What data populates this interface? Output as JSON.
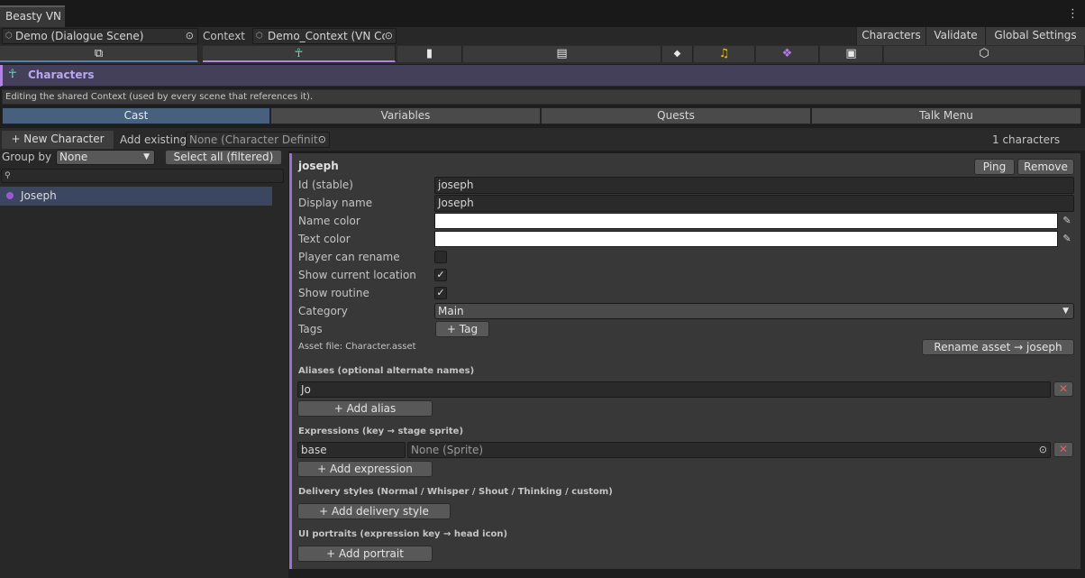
{
  "window": {
    "title": "Beasty VN",
    "menu_icon": "kebab-menu-icon"
  },
  "toolbar": {
    "scene_field": "Demo (Dialogue Scene)",
    "context_label": "Context",
    "context_field": "Demo_Context (VN Cc",
    "buttons": [
      "Characters",
      "Validate",
      "Global Settings"
    ]
  },
  "icon_tabs": [
    {
      "name": "graph-nodes-icon",
      "glyph": "⧉"
    },
    {
      "name": "character-icon",
      "glyph": "☥"
    },
    {
      "name": "page-icon",
      "glyph": "▮"
    },
    {
      "name": "document-icon",
      "glyph": "▤"
    },
    {
      "name": "tag-icon",
      "glyph": "◆"
    },
    {
      "name": "music-note-icon",
      "glyph": "♫"
    },
    {
      "name": "cluster-icon",
      "glyph": "❖"
    },
    {
      "name": "frame-icon",
      "glyph": "▣"
    },
    {
      "name": "cube-icon",
      "glyph": "⬡"
    }
  ],
  "section": {
    "title": "Characters",
    "info": "Editing the shared Context (used by every scene that references it)."
  },
  "subtabs": [
    "Cast",
    "Variables",
    "Quests",
    "Talk Menu"
  ],
  "cast_bar": {
    "new_character": "+ New Character",
    "add_existing": "Add existing",
    "add_existing_field": "None (Character Definiti",
    "count": "1 characters"
  },
  "list": {
    "group_by_label": "Group by",
    "group_by_value": "None",
    "select_all": "Select all (filtered)",
    "search_placeholder": "",
    "items": [
      {
        "name": "Joseph",
        "color": "#9b59d0"
      }
    ]
  },
  "detail": {
    "header": "joseph",
    "ping": "Ping",
    "remove": "Remove",
    "fields": {
      "id_label": "Id (stable)",
      "id_value": "joseph",
      "display_label": "Display name",
      "display_value": "Joseph",
      "name_color_label": "Name color",
      "name_color": "#ffffff",
      "text_color_label": "Text color",
      "text_color": "#ffffff",
      "rename_label": "Player can rename",
      "rename_checked": "",
      "location_label": "Show current location",
      "location_checked": "✓",
      "routine_label": "Show routine",
      "routine_checked": "✓",
      "category_label": "Category",
      "category_value": "Main",
      "tags_label": "Tags",
      "add_tag": "+ Tag",
      "asset_file": "Asset file: Character.asset",
      "rename_asset": "Rename asset → joseph"
    },
    "aliases": {
      "title": "Aliases (optional alternate names)",
      "items": [
        "Jo"
      ],
      "add": "+ Add alias"
    },
    "expressions": {
      "title": "Expressions (key → stage sprite)",
      "key": "base",
      "sprite": "None (Sprite)",
      "add": "+ Add expression"
    },
    "delivery": {
      "title": "Delivery styles (Normal / Whisper / Shout / Thinking / custom)",
      "add": "+ Add delivery style"
    },
    "portraits": {
      "title": "UI portraits (expression key → head icon)",
      "add": "+ Add portrait"
    }
  }
}
